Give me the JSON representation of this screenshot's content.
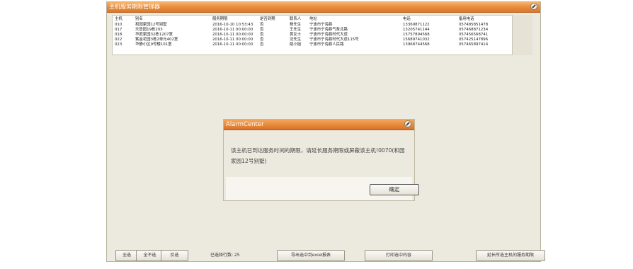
{
  "window": {
    "title": "主机服务期限管理器"
  },
  "table": {
    "headers": [
      "主机",
      "别名",
      "服务期限",
      "是否到期",
      "联系人",
      "地址",
      "电话",
      "备用电话"
    ],
    "rows": [
      [
        "010",
        "和园家园12号别墅",
        "2016-10-10 10:53:43",
        "否",
        "杨先生",
        "宁波市宁海县",
        "13369871122",
        "057485851478"
      ],
      [
        "017",
        "天景园19栋203",
        "2016-10-11 00:00:00",
        "否",
        "王先生",
        "宁波市宁海县气象北路",
        "13205741144",
        "057468871234"
      ],
      [
        "018",
        "华庭家园32栋1207室",
        "2016-10-11 00:00:00",
        "否",
        "黄女士",
        "宁波市宁海县时代大道",
        "15757894568",
        "057456568741"
      ],
      [
        "022",
        "紫金花园3栋2单元402室",
        "2016-10-11 00:00:00",
        "否",
        "沈先生",
        "宁波市宁海县时代大道115号",
        "15689741032",
        "057425147896"
      ],
      [
        "023",
        "华静小区9号楼101室",
        "2016-10-11 00:00:00",
        "否",
        "姚小姐",
        "宁波市宁海县人民路",
        "13968744568",
        "057465897414"
      ]
    ]
  },
  "dialog": {
    "title": "AlarmCenter",
    "message": "该主机已到达服务时间的期限，请延长服务期限或屏蔽该主机!0070(和园家园12号别墅)",
    "ok_label": "确定"
  },
  "footer": {
    "select_all": "全选",
    "select_none": "全不选",
    "invert": "反选",
    "selected_count": "已选择行数: 25",
    "export": "导出选中到excel报表",
    "print": "打印选中内容",
    "extend": "延长所选主机的服务期限"
  }
}
